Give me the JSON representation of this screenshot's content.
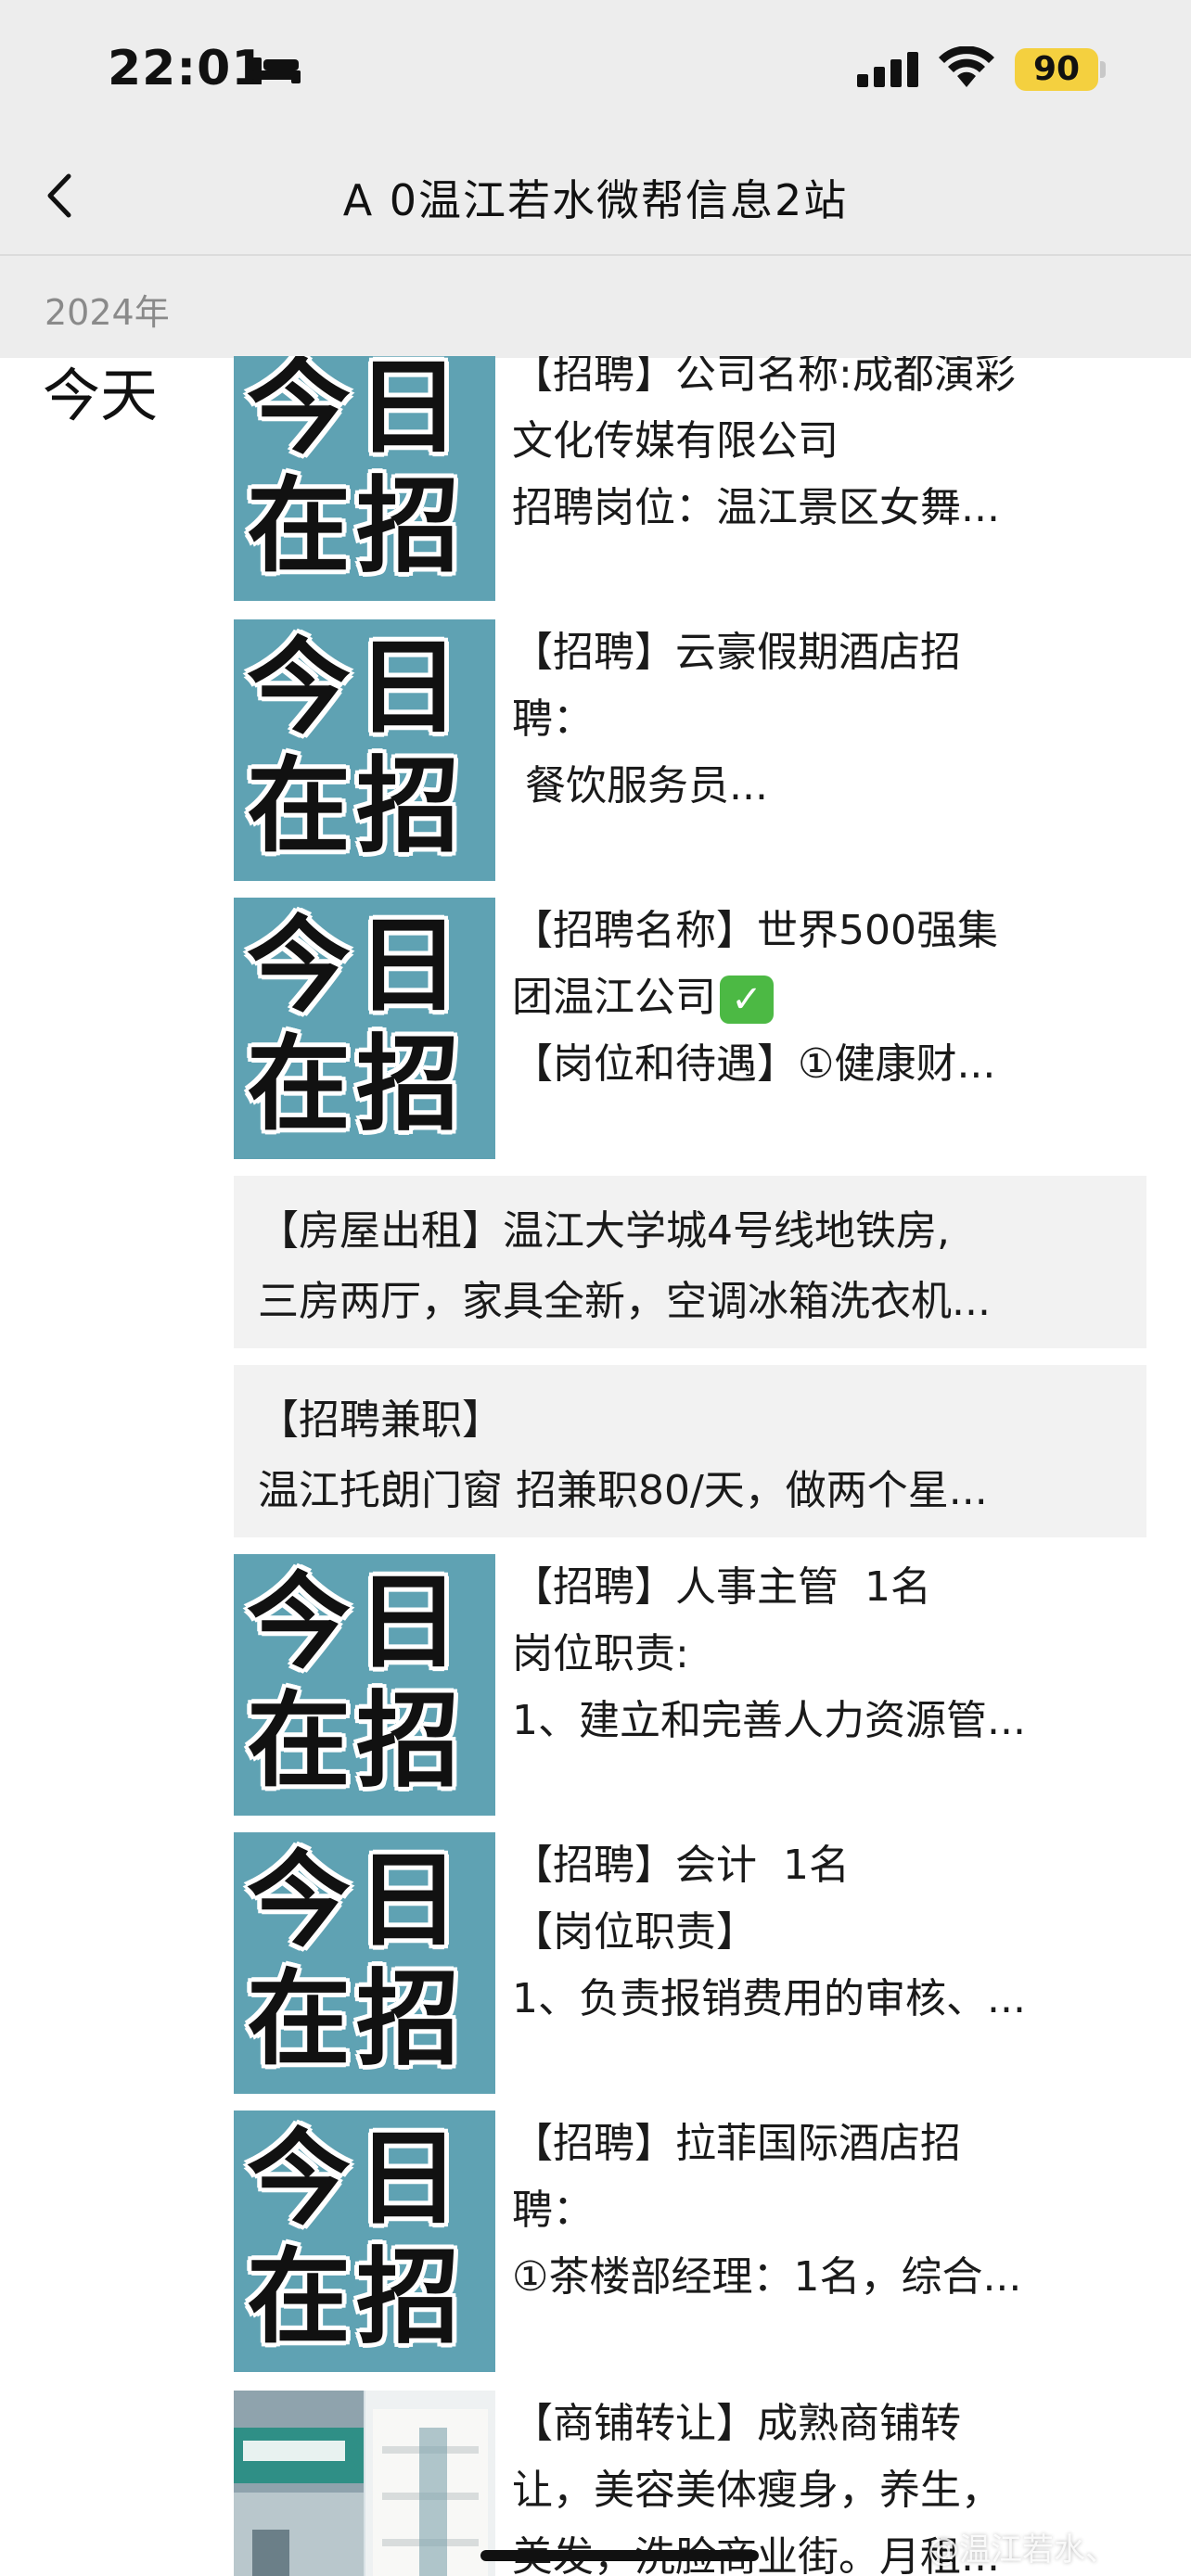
{
  "status_bar": {
    "time": "22:01",
    "battery": "90",
    "icons": [
      "sleep-bed-icon",
      "signal-icon",
      "wifi-icon",
      "battery-icon"
    ]
  },
  "nav": {
    "back_icon": "chevron-left-icon",
    "title": "A 0温江若水微帮信息2站"
  },
  "year": "2024年",
  "day": "今天",
  "thumb_text": [
    "今日",
    "在招"
  ],
  "posts": [
    {
      "lines": [
        "【招聘】公司名称:成都演彩",
        "文化传媒有限公司",
        "招聘岗位：温江景区女舞..."
      ]
    },
    {
      "lines": [
        "【招聘】云豪假期酒店招",
        "聘：",
        " 餐饮服务员..."
      ]
    },
    {
      "lines": [
        "【招聘名称】世界500强集",
        "团温江公司",
        "【岗位和待遇】①健康财..."
      ],
      "check": "✓"
    },
    {
      "lines": [
        "【房屋出租】温江大学城4号线地铁房,",
        "三房两厅，家具全新，空调冰箱洗衣机..."
      ]
    },
    {
      "lines": [
        "【招聘兼职】",
        "温江托朗门窗 招兼职80/天，做两个星..."
      ]
    },
    {
      "lines": [
        "【招聘】人事主管  1名",
        "岗位职责:",
        "1、建立和完善人力资源管..."
      ]
    },
    {
      "lines": [
        "【招聘】会计  1名",
        "【岗位职责】",
        "1、负责报销费用的审核、..."
      ]
    },
    {
      "lines": [
        "【招聘】拉菲国际酒店招",
        "聘：",
        "①茶楼部经理：1名，综合..."
      ]
    },
    {
      "lines": [
        "【商铺转让】成熟商铺转",
        "让，美容美体瘦身，养生，",
        "美发，洗脸商业街。月租..."
      ]
    }
  ],
  "watermark": "@温江若水、"
}
